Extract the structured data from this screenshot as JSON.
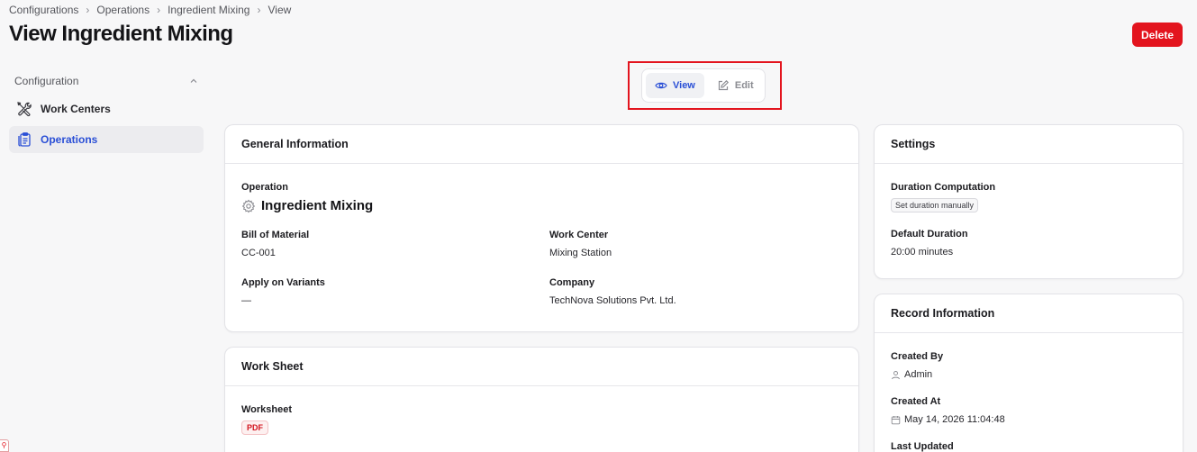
{
  "breadcrumb": [
    "Configurations",
    "Operations",
    "Ingredient Mixing",
    "View"
  ],
  "page_title": "View Ingredient Mixing",
  "delete_label": "Delete",
  "sidebar": {
    "section_label": "Configuration",
    "items": [
      {
        "label": "Work Centers",
        "icon": "tools-icon",
        "active": false
      },
      {
        "label": "Operations",
        "icon": "clipboard-icon",
        "active": true
      }
    ]
  },
  "mode_toggle": {
    "view_label": "View",
    "edit_label": "Edit",
    "active": "view"
  },
  "general": {
    "title": "General Information",
    "operation_label": "Operation",
    "operation_name": "Ingredient Mixing",
    "bom_label": "Bill of Material",
    "bom_value": "CC-001",
    "work_center_label": "Work Center",
    "work_center_value": "Mixing Station",
    "variants_label": "Apply on Variants",
    "variants_value": "—",
    "company_label": "Company",
    "company_value": "TechNova Solutions Pvt. Ltd."
  },
  "worksheet": {
    "title": "Work Sheet",
    "label": "Worksheet",
    "badge": "PDF"
  },
  "settings": {
    "title": "Settings",
    "duration_comp_label": "Duration Computation",
    "duration_comp_value": "Set duration manually",
    "default_duration_label": "Default Duration",
    "default_duration_value": "20:00 minutes"
  },
  "record": {
    "title": "Record Information",
    "created_by_label": "Created By",
    "created_by_value": "Admin",
    "created_at_label": "Created At",
    "created_at_value": "May 14, 2026 11:04:48",
    "last_updated_label": "Last Updated"
  },
  "colors": {
    "accent": "#2a4fd6",
    "danger": "#e3141e",
    "background": "#f7f7f8"
  }
}
